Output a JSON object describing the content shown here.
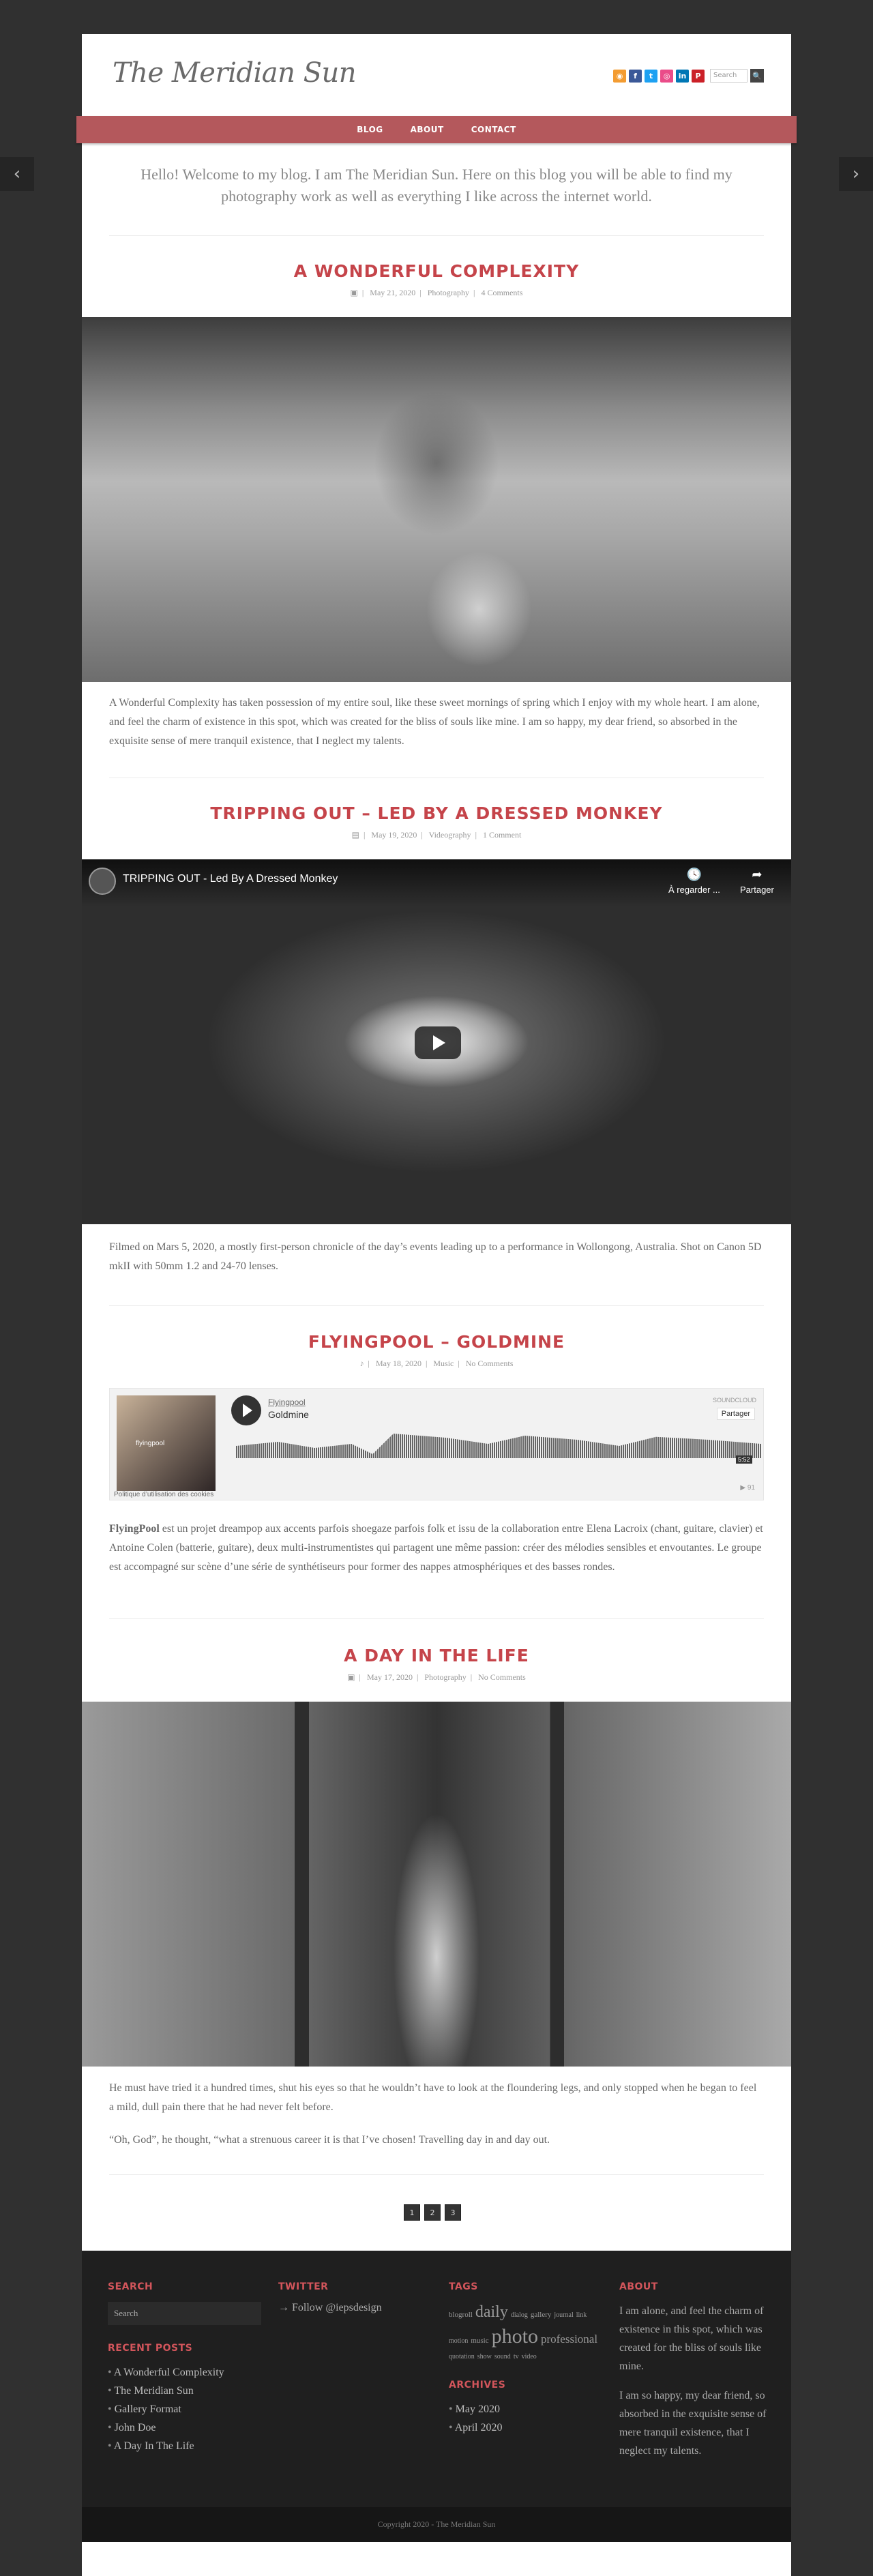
{
  "site": {
    "title": "The Meridian Sun",
    "search_placeholder": "Search",
    "search_button": "🔍",
    "social": [
      {
        "icon": "rss-icon",
        "glyph": "◉",
        "color": "#f39c32"
      },
      {
        "icon": "facebook-icon",
        "glyph": "f",
        "color": "#3b5998"
      },
      {
        "icon": "twitter-icon",
        "glyph": "t",
        "color": "#1da1f2"
      },
      {
        "icon": "dribbble-icon",
        "glyph": "◎",
        "color": "#ea4c89"
      },
      {
        "icon": "linkedin-icon",
        "glyph": "in",
        "color": "#0077b5"
      },
      {
        "icon": "pinterest-icon",
        "glyph": "P",
        "color": "#cb2027"
      }
    ]
  },
  "nav": {
    "items": [
      "BLOG",
      "ABOUT",
      "CONTACT"
    ],
    "prev": "‹",
    "next": "›"
  },
  "intro": "Hello! Welcome to my blog. I am The Meridian Sun. Here on this blog you will be able to find my photography work as well as everything I like across the internet world.",
  "posts": [
    {
      "title": "A WONDERFUL COMPLEXITY",
      "format_icon": "image-icon",
      "format_glyph": "▣",
      "date": "May 21, 2020",
      "category": "Photography",
      "comments": "4 Comments",
      "text": "A Wonderful Complexity has taken possession of my entire soul, like these sweet mornings of spring which I enjoy with my whole heart. I am alone, and feel the charm of existence in this spot, which was created for the bliss of souls like mine. I am so happy, my dear friend, so absorbed in the exquisite sense of mere tranquil existence, that I neglect my talents."
    },
    {
      "title": "TRIPPING OUT – LED BY A DRESSED MONKEY",
      "format_icon": "video-icon",
      "format_glyph": "▤",
      "date": "May 19, 2020",
      "category": "Videography",
      "comments": "1 Comment",
      "text": "Filmed on Mars 5, 2020, a mostly first-person chronicle of the day’s events leading up to a performance in Wollongong, Australia. Shot on Canon 5D mkII with 50mm 1.2 and 24-70 lenses.",
      "video": {
        "title": "TRIPPING OUT - Led By A Dressed Monkey",
        "watch_later": "À regarder ...",
        "share": "Partager"
      }
    },
    {
      "title": "FLYINGPOOL – GOLDMINE",
      "format_icon": "music-icon",
      "format_glyph": "♪",
      "date": "May 18, 2020",
      "category": "Music",
      "comments": "No Comments",
      "text_bold": "FlyingPool",
      "text": " est un projet dreampop aux accents parfois shoegaze parfois folk et issu de la collaboration entre Elena Lacroix (chant, guitare, clavier) et Antoine Colen (batterie, guitare), deux multi-instrumentistes qui partagent une même passion: créer des mélodies sensibles et envoutantes. Le groupe est accompagné sur scène d’une série de synthétiseurs pour former des nappes atmosphériques et des basses rondes.",
      "soundcloud": {
        "artist": "Flyingpool",
        "track": "Goldmine",
        "brand": "SOUNDCLOUD",
        "share": "Partager",
        "duration": "5:52",
        "plays": "▶ 91",
        "cookie": "Politique d’utilisation des cookies",
        "art_label": "flyingpool"
      }
    },
    {
      "title": "A DAY IN THE LIFE",
      "format_icon": "image-icon",
      "format_glyph": "▣",
      "date": "May 17, 2020",
      "category": "Photography",
      "comments": "No Comments",
      "text": "He must have tried it a hundred times, shut his eyes so that he wouldn’t have to look at the floundering legs, and only stopped when he began to feel a mild, dull pain there that he had never felt before.",
      "text2": "“Oh, God”, he thought, “what a strenuous career it is that I’ve chosen! Travelling day in and day out."
    }
  ],
  "pagination": [
    "1",
    "2",
    "3"
  ],
  "footer": {
    "search": {
      "heading": "SEARCH",
      "placeholder": "Search"
    },
    "recent": {
      "heading": "RECENT POSTS",
      "items": [
        "A Wonderful Complexity",
        "The Meridian Sun",
        "Gallery Format",
        "John Doe",
        "A Day In The Life"
      ]
    },
    "twitter": {
      "heading": "TWITTER",
      "follow": "→ Follow @iepsdesign"
    },
    "tags": {
      "heading": "TAGS",
      "items": [
        {
          "label": "blogroll",
          "size": 11
        },
        {
          "label": "daily",
          "size": 24
        },
        {
          "label": "dialog",
          "size": 10
        },
        {
          "label": "gallery",
          "size": 11
        },
        {
          "label": "journal",
          "size": 10
        },
        {
          "label": "link",
          "size": 10
        },
        {
          "label": "motion",
          "size": 10
        },
        {
          "label": "music",
          "size": 11
        },
        {
          "label": "photo",
          "size": 30
        },
        {
          "label": "professional",
          "size": 17
        },
        {
          "label": "quotation",
          "size": 10
        },
        {
          "label": "show",
          "size": 10
        },
        {
          "label": "sound",
          "size": 10
        },
        {
          "label": "tv",
          "size": 10
        },
        {
          "label": "video",
          "size": 10
        }
      ]
    },
    "archives": {
      "heading": "ARCHIVES",
      "items": [
        "May 2020",
        "April 2020"
      ]
    },
    "about": {
      "heading": "ABOUT",
      "p1": "I am alone, and feel the charm of existence in this spot, which was created for the bliss of souls like mine.",
      "p2": "I am so happy, my dear friend, so absorbed in the exquisite sense of mere tranquil existence, that I neglect my talents."
    },
    "copyright": "Copyright 2020 - The Meridian Sun"
  }
}
